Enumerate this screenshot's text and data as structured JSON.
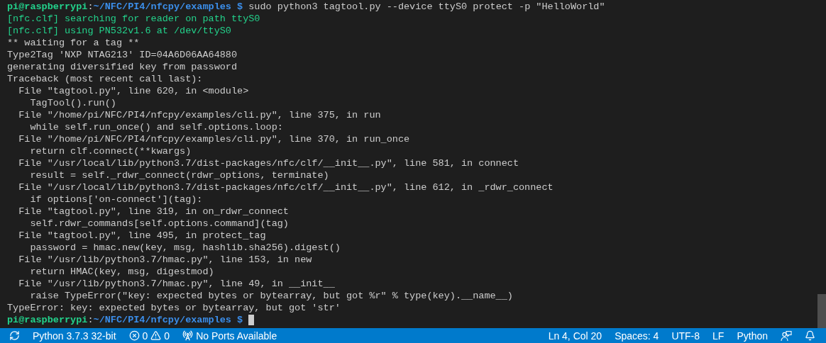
{
  "terminal": {
    "lines": [
      {
        "kind": "prompt",
        "user_host": "pi@raspberrypi",
        "separator": ":",
        "path": "~/NFC/PI4/nfcpy/examples",
        "symbol": "$",
        "command": "sudo python3 tagtool.py --device ttyS0 protect -p \"HelloWorld\""
      },
      {
        "kind": "log",
        "text": "[nfc.clf] searching for reader on path ttyS0"
      },
      {
        "kind": "log",
        "text": "[nfc.clf] using PN532v1.6 at /dev/ttyS0"
      },
      {
        "kind": "plain",
        "text": "** waiting for a tag **"
      },
      {
        "kind": "plain",
        "text": "Type2Tag 'NXP NTAG213' ID=04A6D06AA64880"
      },
      {
        "kind": "plain",
        "text": "generating diversified key from password"
      },
      {
        "kind": "plain",
        "text": "Traceback (most recent call last):"
      },
      {
        "kind": "plain",
        "text": "  File \"tagtool.py\", line 620, in <module>"
      },
      {
        "kind": "plain",
        "text": "    TagTool().run()"
      },
      {
        "kind": "plain",
        "text": "  File \"/home/pi/NFC/PI4/nfcpy/examples/cli.py\", line 375, in run"
      },
      {
        "kind": "plain",
        "text": "    while self.run_once() and self.options.loop:"
      },
      {
        "kind": "plain",
        "text": "  File \"/home/pi/NFC/PI4/nfcpy/examples/cli.py\", line 370, in run_once"
      },
      {
        "kind": "plain",
        "text": "    return clf.connect(**kwargs)"
      },
      {
        "kind": "plain",
        "text": "  File \"/usr/local/lib/python3.7/dist-packages/nfc/clf/__init__.py\", line 581, in connect"
      },
      {
        "kind": "plain",
        "text": "    result = self._rdwr_connect(rdwr_options, terminate)"
      },
      {
        "kind": "plain",
        "text": "  File \"/usr/local/lib/python3.7/dist-packages/nfc/clf/__init__.py\", line 612, in _rdwr_connect"
      },
      {
        "kind": "plain",
        "text": "    if options['on-connect'](tag):"
      },
      {
        "kind": "plain",
        "text": "  File \"tagtool.py\", line 319, in on_rdwr_connect"
      },
      {
        "kind": "plain",
        "text": "    self.rdwr_commands[self.options.command](tag)"
      },
      {
        "kind": "plain",
        "text": "  File \"tagtool.py\", line 495, in protect_tag"
      },
      {
        "kind": "plain",
        "text": "    password = hmac.new(key, msg, hashlib.sha256).digest()"
      },
      {
        "kind": "plain",
        "text": "  File \"/usr/lib/python3.7/hmac.py\", line 153, in new"
      },
      {
        "kind": "plain",
        "text": "    return HMAC(key, msg, digestmod)"
      },
      {
        "kind": "plain",
        "text": "  File \"/usr/lib/python3.7/hmac.py\", line 49, in __init__"
      },
      {
        "kind": "plain",
        "text": "    raise TypeError(\"key: expected bytes or bytearray, but got %r\" % type(key).__name__)"
      },
      {
        "kind": "plain",
        "text": "TypeError: key: expected bytes or bytearray, but got 'str'"
      },
      {
        "kind": "prompt",
        "user_host": "pi@raspberrypi",
        "separator": ":",
        "path": "~/NFC/PI4/nfcpy/examples",
        "symbol": "$",
        "cursor": true
      }
    ]
  },
  "status_bar": {
    "interpreter": "Python 3.7.3 32-bit",
    "errors": "0",
    "warnings": "0",
    "ports": "No Ports Available",
    "position": "Ln 4, Col 20",
    "indentation": "Spaces: 4",
    "encoding": "UTF-8",
    "line_ending": "LF",
    "language": "Python"
  }
}
